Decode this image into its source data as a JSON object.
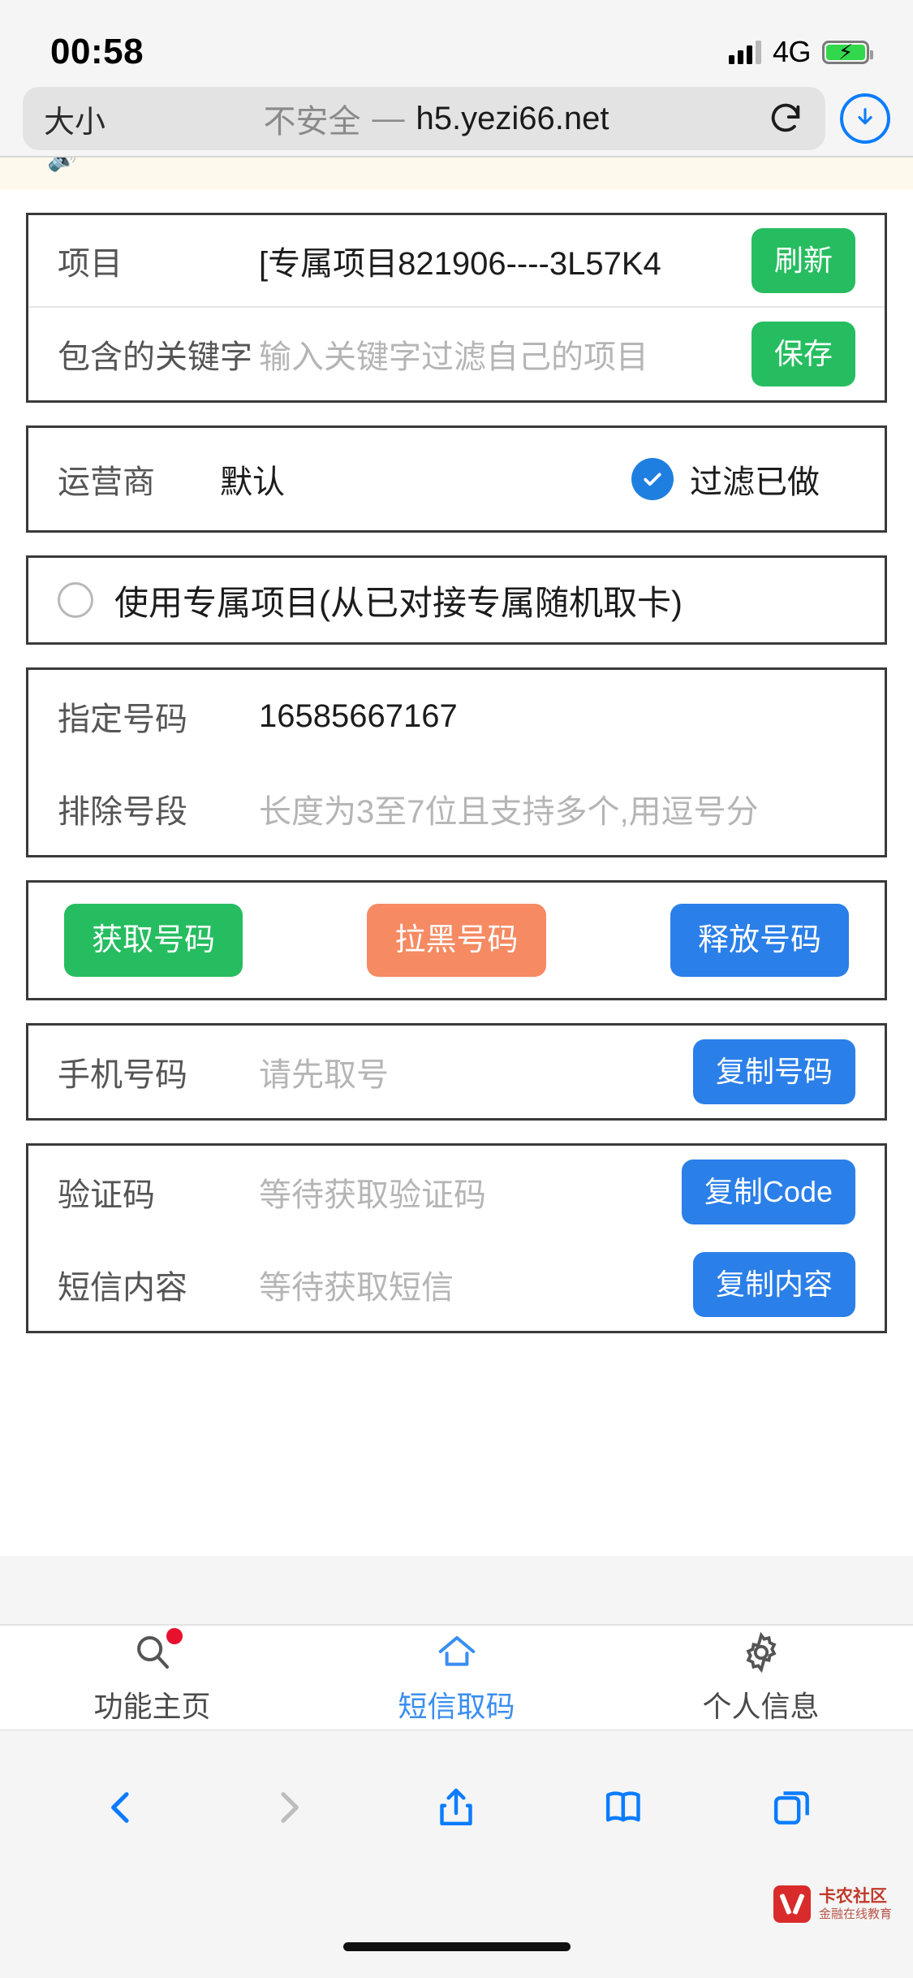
{
  "status_bar": {
    "time": "00:58",
    "network": "4G",
    "signal_icon": "signal-bars-icon",
    "battery_icon": "battery-charging-icon"
  },
  "browser": {
    "size_button": "大小",
    "insecure_label": "不安全",
    "separator": "—",
    "host": "h5.yezi66.net",
    "reload_icon": "reload-icon",
    "download_icon": "download-icon"
  },
  "notice": {
    "speaker_icon": "speaker-icon"
  },
  "form": {
    "project": {
      "label": "项目",
      "value": "[专属项目821906----3L57K4",
      "button": "刷新"
    },
    "keyword": {
      "label": "包含的关键字",
      "placeholder": "输入关键字过滤自己的项目",
      "button": "保存"
    },
    "operator": {
      "label": "运营商",
      "value": "默认",
      "filter_done_label": "过滤已做",
      "filter_done_checked": true,
      "check_icon": "check-icon"
    },
    "exclusive": {
      "label": "使用专属项目(从已对接专属随机取卡)",
      "selected": false,
      "radio_icon": "radio-unchecked-icon"
    },
    "assigned_number": {
      "label": "指定号码",
      "value": "16585667167"
    },
    "exclude_segment": {
      "label": "排除号段",
      "placeholder": "长度为3至7位且支持多个,用逗号分"
    },
    "actions": [
      {
        "label": "获取号码",
        "color": "#26bd60",
        "style": "green"
      },
      {
        "label": "拉黑号码",
        "color": "#f58a63",
        "style": "orange"
      },
      {
        "label": "释放号码",
        "color": "#2b7fe8",
        "style": "blue"
      }
    ],
    "phone": {
      "label": "手机号码",
      "placeholder": "请先取号",
      "button": "复制号码"
    },
    "code": {
      "label": "验证码",
      "placeholder": "等待获取验证码",
      "button": "复制Code"
    },
    "sms": {
      "label": "短信内容",
      "placeholder": "等待获取短信",
      "button": "复制内容"
    }
  },
  "tabbar": {
    "items": [
      {
        "label": "功能主页",
        "icon": "search-icon",
        "active": false,
        "badge": true
      },
      {
        "label": "短信取码",
        "icon": "home-icon",
        "active": true,
        "badge": false
      },
      {
        "label": "个人信息",
        "icon": "gear-icon",
        "active": false,
        "badge": false
      }
    ]
  },
  "toolbar": {
    "back_icon": "chevron-left-icon",
    "forward_icon": "chevron-right-icon",
    "share_icon": "share-icon",
    "bookmarks_icon": "book-icon",
    "tabs_icon": "tabs-icon"
  },
  "watermark": {
    "line1": "卡农社区",
    "line2": "金融在线教育"
  },
  "colors": {
    "accent_blue": "#2b7fe8",
    "green": "#26bd60",
    "orange": "#f58a63",
    "badge_red": "#e8112d",
    "safari_blue": "#0a7cff"
  }
}
